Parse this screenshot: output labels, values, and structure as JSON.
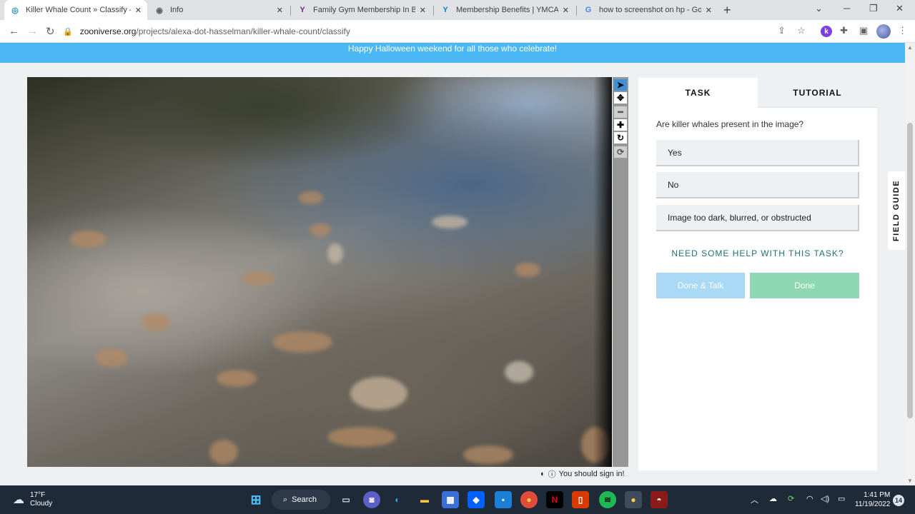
{
  "browser": {
    "tabs": [
      {
        "title": "Killer Whale Count » Classify — Z",
        "icon": "zooniverse-icon",
        "active": true
      },
      {
        "title": "Info",
        "icon": "globe-icon",
        "active": false
      },
      {
        "title": "Family Gym Membership In Burn",
        "icon": "ymca-icon",
        "active": false
      },
      {
        "title": "Membership Benefits | YMCA of",
        "icon": "ymca-icon",
        "active": false
      },
      {
        "title": "how to screenshot on hp - Goog",
        "icon": "google-icon",
        "active": false
      }
    ],
    "url_domain": "zooniverse.org",
    "url_path": "/projects/alexa-dot-hasselman/killer-whale-count/classify",
    "extension_letter": "k"
  },
  "banner": {
    "text": "Happy Halloween weekend for all those who celebrate!",
    "color": "#4cb8f3"
  },
  "image_tools": [
    "pointer-icon",
    "pan-icon",
    "zoom-out-icon",
    "zoom-in-icon",
    "rotate-icon",
    "reset-icon"
  ],
  "signin": {
    "text": "You should sign in!"
  },
  "panel": {
    "tab_task": "TASK",
    "tab_tutorial": "TUTORIAL",
    "question": "Are killer whales present in the image?",
    "answers": [
      "Yes",
      "No",
      "Image too dark, blurred, or obstructed"
    ],
    "help": "NEED SOME HELP WITH THIS TASK?",
    "done_talk": "Done & Talk",
    "done": "Done",
    "accent_color": "#1f6f78"
  },
  "field_guide": {
    "label": "FIELD GUIDE"
  },
  "taskbar": {
    "weather_temp": "17°F",
    "weather_cond": "Cloudy",
    "search_label": "Search",
    "time": "1:41 PM",
    "date": "11/19/2022",
    "notifications": "14"
  }
}
